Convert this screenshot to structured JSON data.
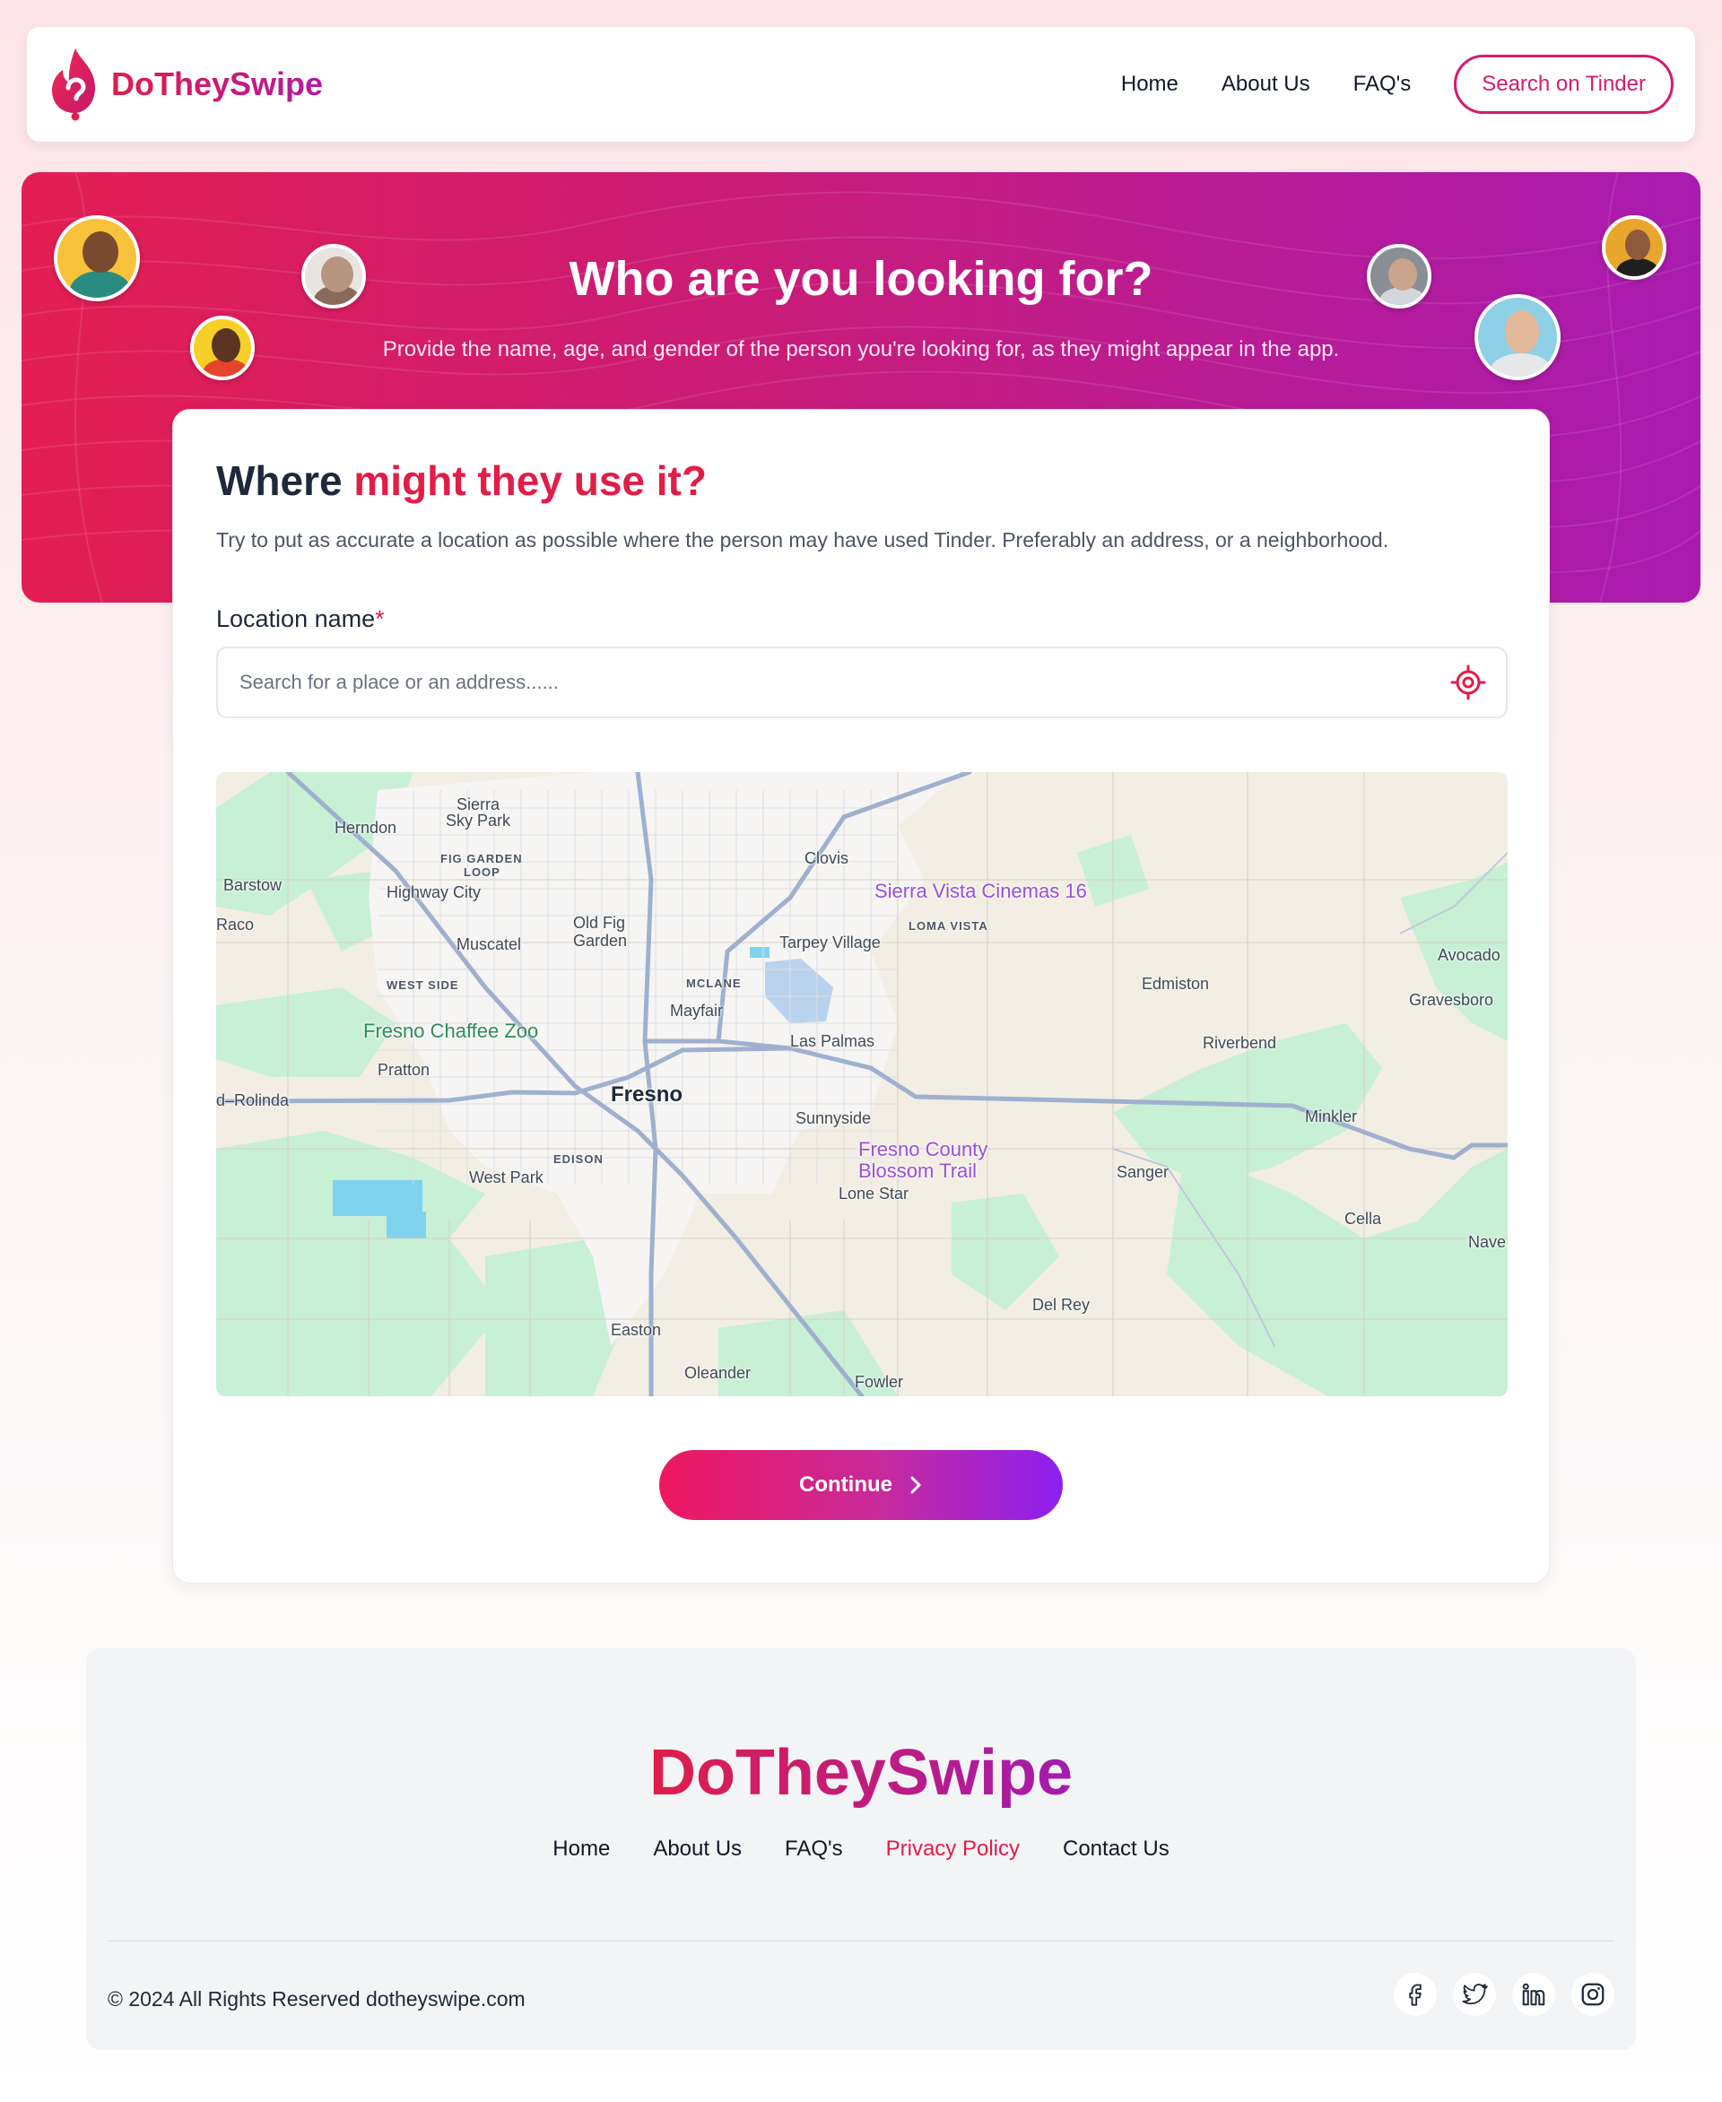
{
  "brand": {
    "name": "DoTheySwipe"
  },
  "nav": {
    "links": [
      "Home",
      "About Us",
      "FAQ's"
    ],
    "cta": "Search on Tinder"
  },
  "hero": {
    "title": "Who are you looking for?",
    "subtitle": "Provide the name, age, and gender of the person you're looking for, as they might appear in the app."
  },
  "form": {
    "title_part1": "Where ",
    "title_part2": "might they use it?",
    "description": "Try to put as accurate a location as possible where the person may have used Tinder. Preferably an address, or a neighborhood.",
    "location_label": "Location name",
    "required_mark": "*",
    "location_placeholder": "Search for a place or an address......",
    "location_value": "",
    "continue_label": "Continue"
  },
  "map": {
    "labels": {
      "sierra": "Sierra",
      "sky_park": "Sky Park",
      "herndon": "Herndon",
      "fig_garden": "FIG GARDEN",
      "loop": "LOOP",
      "clovis": "Clovis",
      "barstow": "Barstow",
      "highway_city": "Highway City",
      "sierra_vista": "Sierra Vista Cinemas 16",
      "raco": "Raco",
      "old_fig": "Old Fig",
      "garden": "Garden",
      "loma_vista": "LOMA VISTA",
      "tarpey": "Tarpey Village",
      "muscatel": "Muscatel",
      "avocado": "Avocado",
      "west_side": "WEST SIDE",
      "mclane": "MCLANE",
      "edmiston": "Edmiston",
      "gravesboro": "Gravesboro",
      "mayfair": "Mayfair",
      "zoo": "Fresno Chaffee Zoo",
      "las_palmas": "Las Palmas",
      "riverbend": "Riverbend",
      "pratton": "Pratton",
      "fresno": "Fresno",
      "rolinda": "d–Rolinda",
      "sunnyside": "Sunnyside",
      "minkler": "Minkler",
      "blossom1": "Fresno County",
      "blossom2": "Blossom Trail",
      "edison": "EDISON",
      "sanger": "Sanger",
      "west_park": "West Park",
      "lone_star": "Lone Star",
      "cella": "Cella",
      "nave": "Nave",
      "del_rey": "Del Rey",
      "easton": "Easton",
      "oleander": "Oleander",
      "fowler": "Fowler"
    }
  },
  "footer": {
    "brand": "DoTheySwipe",
    "links": [
      "Home",
      "About Us",
      "FAQ's",
      "Privacy Policy",
      "Contact Us"
    ],
    "copyright": "© 2024 All Rights Reserved dotheyswipe.com",
    "social_icons": [
      "facebook-icon",
      "twitter-icon",
      "linkedin-icon",
      "instagram-icon"
    ]
  },
  "colors": {
    "brand_red": "#e11d48",
    "brand_purple": "#a21caf",
    "cta_magenta": "#d61a6f"
  }
}
